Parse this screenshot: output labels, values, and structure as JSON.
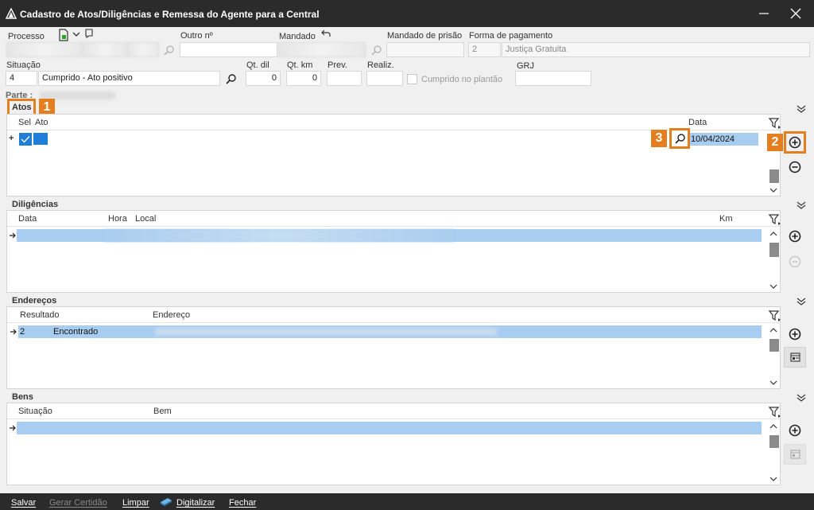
{
  "window": {
    "title": "Cadastro de Atos/Diligências e Remessa do Agente para a Central"
  },
  "header": {
    "processo_label": "Processo",
    "outro_label": "Outro nº",
    "mandado_label": "Mandado",
    "mandado_prisao_label": "Mandado de prisão",
    "forma_pagamento_label": "Forma de pagamento",
    "forma_pagamento_code": "2",
    "forma_pagamento_value": "Justiça Gratuita",
    "situacao_label": "Situação",
    "situacao_code": "4",
    "situacao_value": "Cumprido - Ato positivo",
    "qt_dil_label": "Qt. dil",
    "qt_dil_value": "0",
    "qt_km_label": "Qt. km",
    "qt_km_value": "0",
    "prev_label": "Prev.",
    "realiz_label": "Realiz.",
    "cumprido_label": "Cumprido no plantão",
    "grj_label": "GRJ",
    "parte_label": "Parte :"
  },
  "atos": {
    "title": "Atos",
    "col_sel": "Sel",
    "col_ato": "Ato",
    "col_data": "Data",
    "row_expand": "+",
    "row_date": "10/04/2024"
  },
  "diligencias": {
    "title": "Diligências",
    "col_data": "Data",
    "col_hora": "Hora",
    "col_local": "Local",
    "col_km": "Km"
  },
  "enderecos": {
    "title": "Endereços",
    "col_resultado": "Resultado",
    "col_endereco": "Endereço",
    "row_num": "2",
    "row_resultado": "Encontrado"
  },
  "bens": {
    "title": "Bens",
    "col_situacao": "Situação",
    "col_bem": "Bem"
  },
  "annotations": {
    "one": "1",
    "two": "2",
    "three": "3"
  },
  "footer": {
    "salvar": "Salvar",
    "gerar_certidao": "Gerar Certidão",
    "limpar": "Limpar",
    "digitalizar": "Digitalizar",
    "fechar": "Fechar"
  },
  "colors": {
    "accent": "#e57e1e",
    "selection": "#a9cdf0",
    "titlebar": "#2b2b2b",
    "check": "#1f7fd8"
  }
}
